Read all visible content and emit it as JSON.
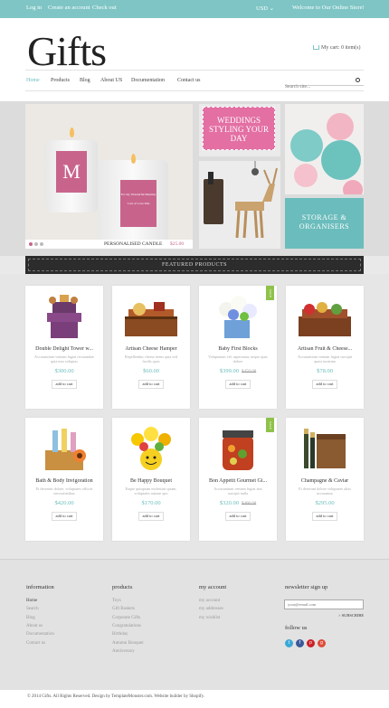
{
  "topbar": {
    "login": "Log in",
    "create": "Create an account",
    "checkout": "Check out",
    "currency": "USD",
    "welcome": "Welcome to Our Online Store!"
  },
  "header": {
    "logo": "Gifts",
    "cart": "My cart: 0 item(s)"
  },
  "nav": {
    "items": [
      "Home",
      "Products",
      "Blog",
      "About US",
      "Documentation",
      "Contact us"
    ],
    "search_placeholder": "Search site..."
  },
  "banners": {
    "candle_caption": "PERSONALISED CANDLE",
    "candle_price": "$25.00",
    "candle_label_text": "M",
    "candle_small_label": "For my Wonderful Mummy",
    "candle_small_label2": "Lots of Love Mia",
    "weddings": "WEDDINGS STYLING YOUR DAY",
    "storage": "STORAGE & ORGANISERS"
  },
  "featured_title": "FEATURED PRODUCTS",
  "products": [
    {
      "name": "Double Delight Tower w...",
      "desc": "Accusantium veniam fugiat recusandae quia non voluptas",
      "price": "$300.00",
      "old": "",
      "sale": false,
      "add": "add to cart"
    },
    {
      "name": "Artisan Cheese Hamper",
      "desc": "Repellendus cheese items quia sed facilis quos",
      "price": "$60.00",
      "old": "",
      "sale": false,
      "add": "add to cart"
    },
    {
      "name": "Baby First Blocks",
      "desc": "Voluptatum vel, aspernatur, neque quas dolore",
      "price": "$399.00",
      "old": "$450.00",
      "sale": true,
      "add": "add to cart"
    },
    {
      "name": "Artisan Fruit & Cheese...",
      "desc": "Accusantium veniam fugiat suscipit quasi nostrum",
      "price": "$78.00",
      "old": "",
      "sale": false,
      "add": "add to cart"
    },
    {
      "name": "Bath & Body Invigoration",
      "desc": "Et deserunt dolore, voluptates officiis necessitatibus",
      "price": "$420.00",
      "old": "",
      "sale": false,
      "add": "add to cart"
    },
    {
      "name": "Be Happy Bouquet",
      "desc": "Eaque quisquam molestiae ipsam, voluptates ratione quo",
      "price": "$170.00",
      "old": "",
      "sale": false,
      "add": "add to cart"
    },
    {
      "name": "Bon Appetit Gourmet Gi...",
      "desc": "Accusantium veniam fugiat sint suscipit nulla",
      "price": "$320.00",
      "old": "$400.00",
      "sale": true,
      "add": "add to cart"
    },
    {
      "name": "Champagne & Caviar",
      "desc": "Et deserunt dolore voluptates alias accusamus",
      "price": "$295.00",
      "old": "",
      "sale": false,
      "add": "add to cart"
    }
  ],
  "sale_label": "SALE",
  "footer": {
    "information": {
      "title": "information",
      "links": [
        "Home",
        "Search",
        "Blog",
        "About us",
        "Documentation",
        "Contact us"
      ]
    },
    "products": {
      "title": "products",
      "links": [
        "Toys",
        "Gift Baskets",
        "Corporate Gifts",
        "Congratulations",
        "Birthday",
        "Autumn Bouquet",
        "Anniversary"
      ]
    },
    "account": {
      "title": "my account",
      "links": [
        "my account",
        "my addresses",
        "my wishlist"
      ]
    },
    "newsletter": {
      "title": "newsletter sign up",
      "placeholder": "your@email.com",
      "subscribe": "> SUBSCRIBE"
    },
    "follow": "follow us",
    "social": [
      "t",
      "f",
      "p",
      "g"
    ],
    "copyright": "© 2014 Gifts. All Rights Reserved. Design by TemplateMonster.com. Website builder by Shopify."
  }
}
